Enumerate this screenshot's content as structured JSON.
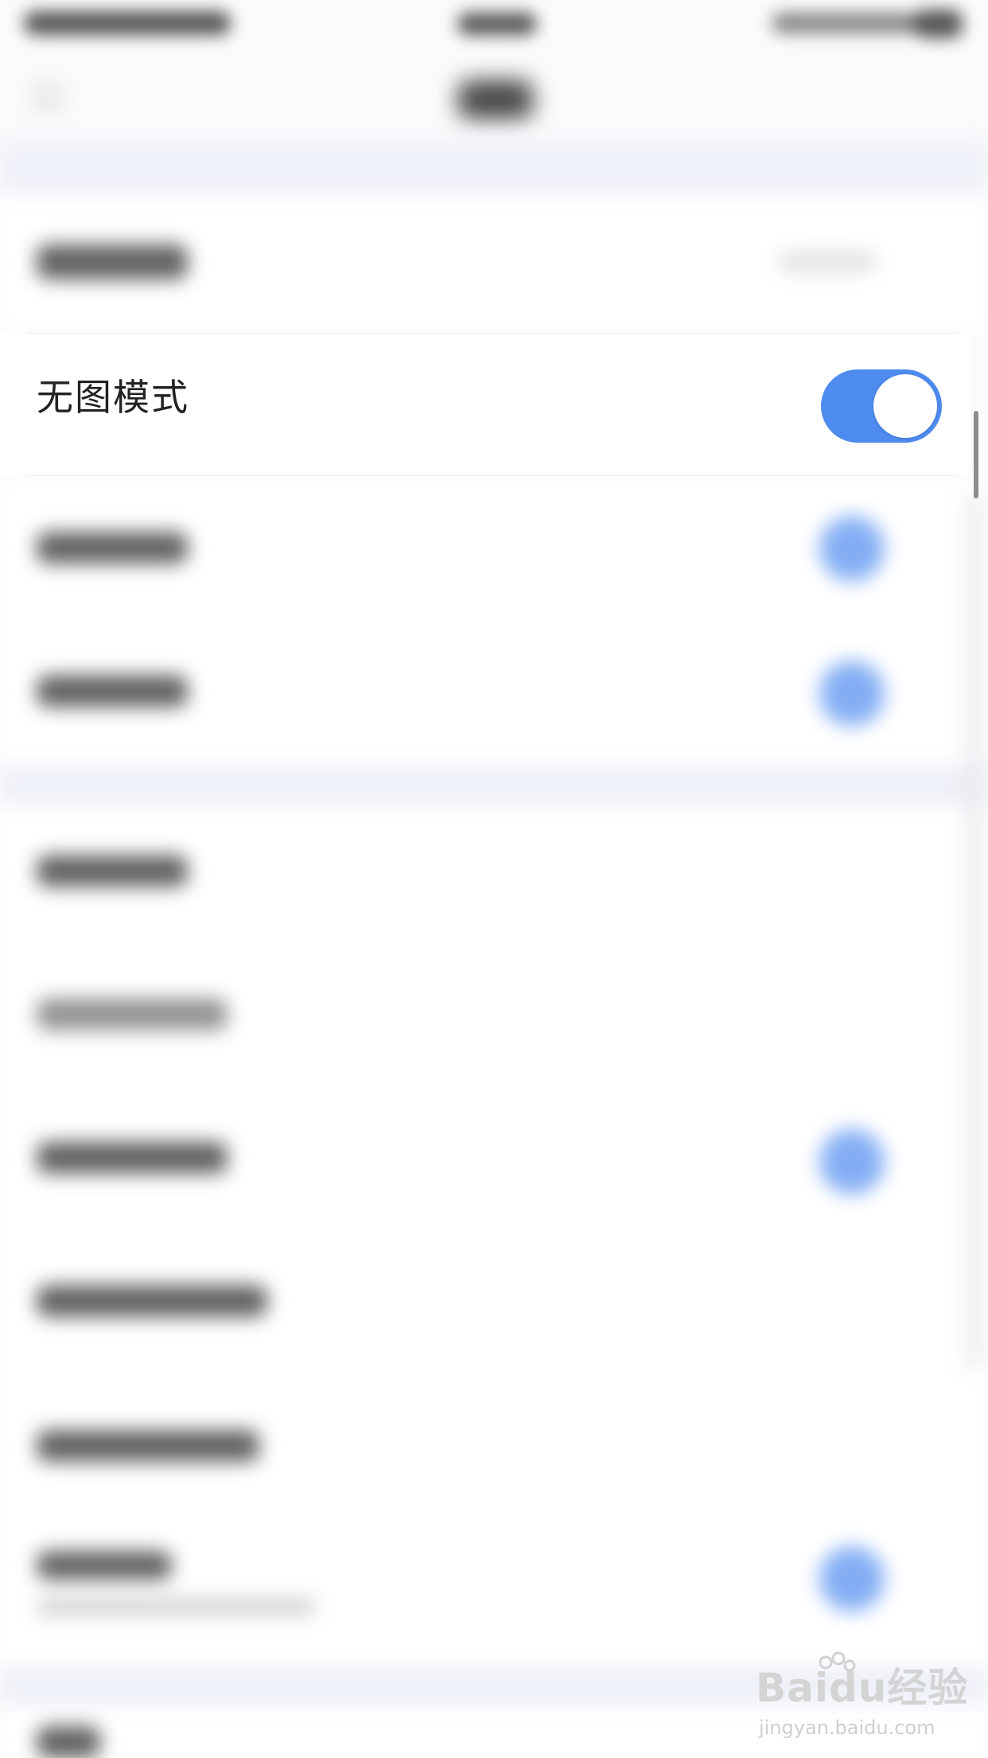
{
  "settings": {
    "no_image_mode": {
      "label": "无图模式",
      "enabled": true
    }
  },
  "colors": {
    "toggle_on": "#4e8bef",
    "background": "#fbfbfc",
    "section_gap": "#eef1f7"
  },
  "watermark": {
    "logo": "Baidu经验",
    "site": "jingyan.baidu.com"
  }
}
